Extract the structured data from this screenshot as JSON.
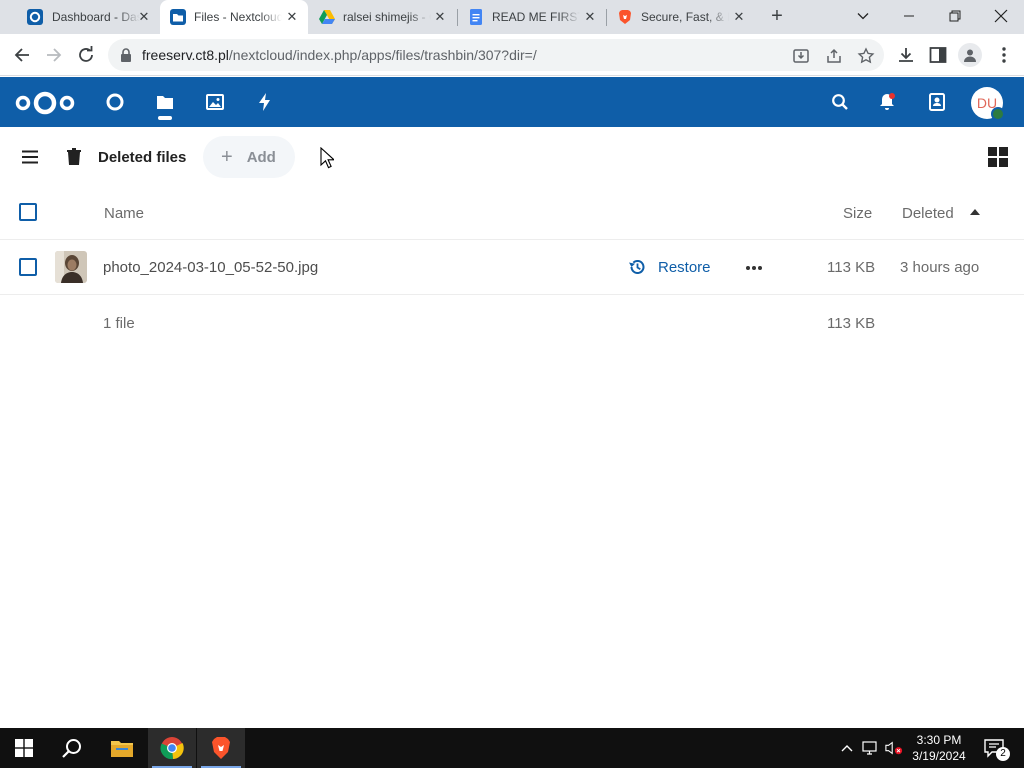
{
  "browser": {
    "tabs": [
      {
        "title": "Dashboard - Dashboard",
        "icon": "nextcloud-favicon-icon",
        "active": false
      },
      {
        "title": "Files - Nextcloud",
        "icon": "nextcloud-files-favicon-icon",
        "active": true
      },
      {
        "title": "ralsei shimejis - Google Drive",
        "icon": "google-drive-icon",
        "active": false
      },
      {
        "title": "READ ME FIRST",
        "icon": "google-docs-icon",
        "active": false
      },
      {
        "title": "Secure, Fast, & Private",
        "icon": "brave-icon",
        "active": false
      }
    ],
    "tab_close_glyph": "✕",
    "new_tab_glyph": "+",
    "window_controls": {
      "list": "⌄",
      "minimize": "—",
      "restore": "❐",
      "close": "✕"
    },
    "url_host": "freeserv.ct8.pl",
    "url_path": "/nextcloud/index.php/apps/files/trashbin/307?dir=/"
  },
  "header": {
    "apps": [
      "dashboard-icon",
      "files-icon",
      "photos-icon",
      "activity-icon"
    ],
    "active_app": "files",
    "avatar_initials": "DU",
    "colors": {
      "header_bg": "#0f5ea8",
      "accent": "#0f5ea8",
      "status_online": "#2d7b41"
    }
  },
  "files": {
    "breadcrumb": "Deleted files",
    "add_label": "Add",
    "columns": {
      "name": "Name",
      "size": "Size",
      "deleted": "Deleted"
    },
    "rows": [
      {
        "name": "photo_2024-03-10_05-52-50.jpg",
        "action": "Restore",
        "size": "113 KB",
        "deleted": "3 hours ago"
      }
    ],
    "summary": {
      "count": "1 file",
      "size": "113 KB"
    }
  },
  "taskbar": {
    "apps": [
      "windows-start-icon",
      "search-icon",
      "file-explorer-icon",
      "chrome-icon",
      "brave-icon"
    ],
    "clock_time": "3:30 PM",
    "clock_date": "3/19/2024",
    "notification_count": "2"
  }
}
